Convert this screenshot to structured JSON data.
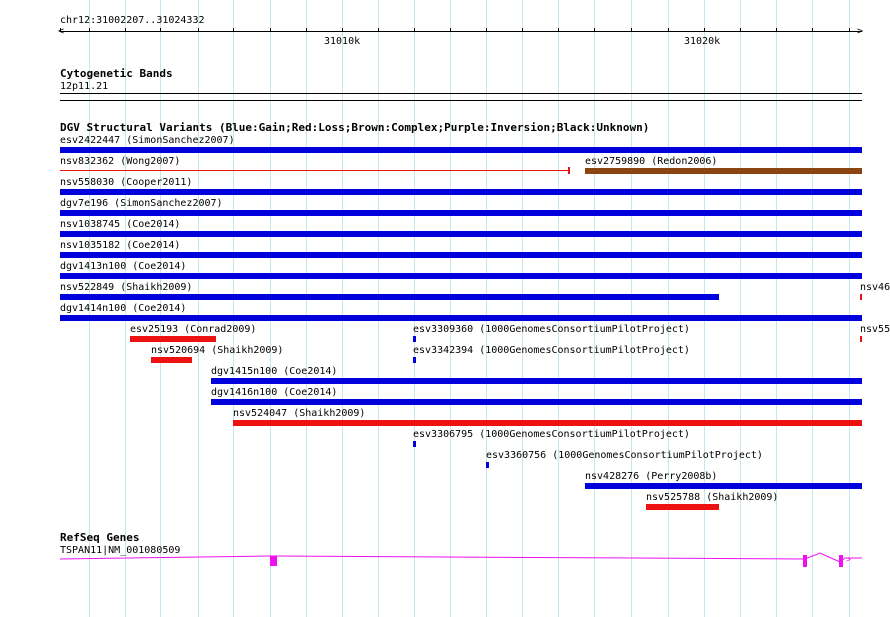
{
  "ruler": {
    "location": "chr12:31002207..31024332",
    "tick_labels": [
      "31010k",
      "31020k"
    ]
  },
  "cytoband": {
    "title": "Cytogenetic Bands",
    "band": "12p11.21"
  },
  "dgv": {
    "title": "DGV Structural Variants (Blue:Gain;Red:Loss;Brown:Complex;Purple:Inversion;Black:Unknown)",
    "colors": {
      "gain": "#0000dd",
      "loss": "#ee1111",
      "complex": "#8b4513"
    },
    "features": [
      {
        "label": "esv2422447 (SimonSanchez2007)",
        "type": "gain"
      },
      {
        "label": "nsv832362 (Wong2007)",
        "type": "loss"
      },
      {
        "label": "esv2759890 (Redon2006)",
        "type": "complex"
      },
      {
        "label": "nsv558030 (Cooper2011)",
        "type": "gain"
      },
      {
        "label": "dgv7e196 (SimonSanchez2007)",
        "type": "gain"
      },
      {
        "label": "nsv1038745 (Coe2014)",
        "type": "gain"
      },
      {
        "label": "nsv1035182 (Coe2014)",
        "type": "gain"
      },
      {
        "label": "dgv1413n100 (Coe2014)",
        "type": "gain"
      },
      {
        "label": "nsv522849 (Shaikh2009)",
        "type": "gain"
      },
      {
        "label": "nsv46",
        "type": "loss"
      },
      {
        "label": "dgv1414n100 (Coe2014)",
        "type": "gain"
      },
      {
        "label": "esv25193 (Conrad2009)",
        "type": "loss"
      },
      {
        "label": "esv3309360 (1000GenomesConsortiumPilotProject)",
        "type": "gain"
      },
      {
        "label": "nsv55",
        "type": "loss"
      },
      {
        "label": "nsv520694 (Shaikh2009)",
        "type": "loss"
      },
      {
        "label": "esv3342394 (1000GenomesConsortiumPilotProject)",
        "type": "gain"
      },
      {
        "label": "dgv1415n100 (Coe2014)",
        "type": "gain"
      },
      {
        "label": "dgv1416n100 (Coe2014)",
        "type": "gain"
      },
      {
        "label": "nsv524047 (Shaikh2009)",
        "type": "loss"
      },
      {
        "label": "esv3306795 (1000GenomesConsortiumPilotProject)",
        "type": "gain"
      },
      {
        "label": "esv3360756 (1000GenomesConsortiumPilotProject)",
        "type": "gain"
      },
      {
        "label": "nsv428276 (Perry2008b)",
        "type": "gain"
      },
      {
        "label": "nsv525788 (Shaikh2009)",
        "type": "loss"
      }
    ]
  },
  "refseq": {
    "title": "RefSeq Genes",
    "gene": "TSPAN11|NM_001080509",
    "color": "#ee11ee"
  }
}
